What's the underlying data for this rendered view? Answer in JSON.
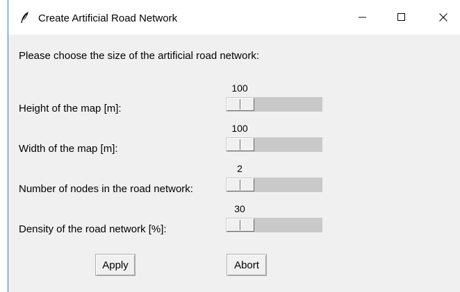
{
  "window": {
    "title": "Create Artificial Road Network",
    "icon": "feather-icon",
    "controls": [
      "minimize-icon",
      "maximize-icon",
      "close-icon"
    ]
  },
  "prompt": "Please choose the size of the artificial road network:",
  "scales": [
    {
      "label": "Height of the map [m]:",
      "value": "100",
      "position_fraction": 0.0
    },
    {
      "label": "Width of the map [m]:",
      "value": "100",
      "position_fraction": 0.0
    },
    {
      "label": "Number of nodes in the road network:",
      "value": "2",
      "position_fraction": 0.0
    },
    {
      "label": "Density of the road network [%]:",
      "value": "30",
      "position_fraction": 0.0
    }
  ],
  "buttons": {
    "apply": "Apply",
    "abort": "Abort"
  }
}
